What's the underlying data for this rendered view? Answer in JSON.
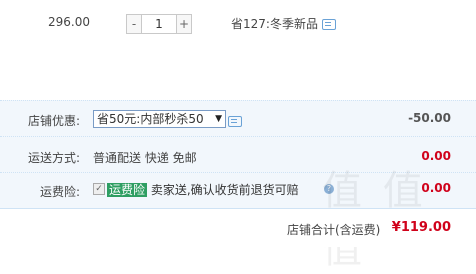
{
  "item": {
    "price": "296.00",
    "minus": "-",
    "quantity": "1",
    "plus": "+",
    "promo": "省127:冬季新品"
  },
  "order": {
    "discount": {
      "label": "店铺优惠:",
      "select_value": "省50元:内部秒杀50",
      "amount": "-50.00"
    },
    "shipping": {
      "label": "运送方式:",
      "value": "普通配送 快递 免邮",
      "amount": "0.00"
    },
    "insurance": {
      "label": "运费险:",
      "tag": "运费险",
      "text": "卖家送,确认收货前退货可赔",
      "amount": "0.00"
    }
  },
  "total": {
    "label": "店铺合计(含运费)",
    "amount": "¥119.00"
  },
  "watermark": "值 值 值",
  "colors": {
    "price_red": "#d0021b",
    "panel_bg": "#f2f7fc",
    "tag_green": "#2e9e62"
  }
}
